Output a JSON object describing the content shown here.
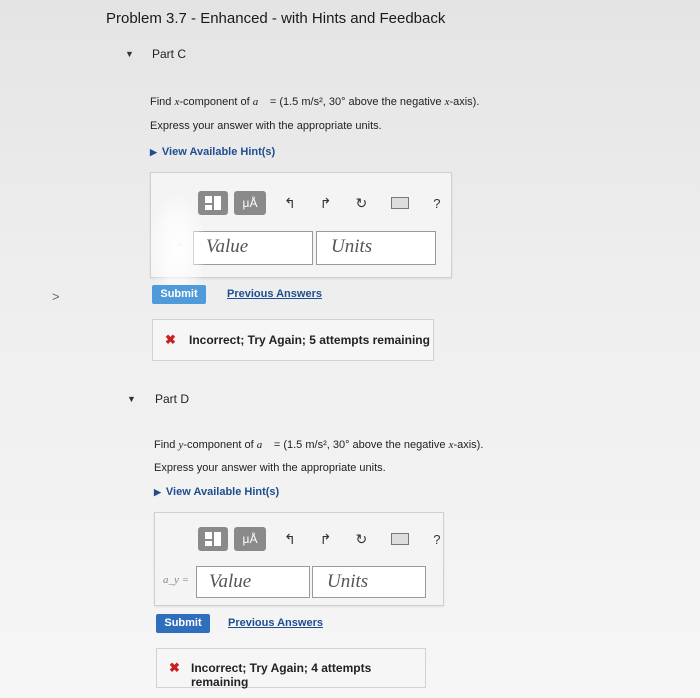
{
  "title": "Problem 3.7 - Enhanced - with Hints and Feedback",
  "nav": {
    "chevron": ">"
  },
  "parts": [
    {
      "id": "C",
      "label": "Part C",
      "question_prefix": "Find ",
      "question_var": "x",
      "question_mid": "-component of ",
      "vector": "a⃗",
      "question_value": " = (1.5 m/s², 30° above the negative ",
      "question_axis": "x",
      "question_suffix": "-axis).",
      "instruction": "Express your answer with the appropriate units.",
      "hint_link": "View Available Hint(s)",
      "units_btn": "μÅ",
      "help": "?",
      "input_label": "=",
      "value_placeholder": "Value",
      "units_placeholder": "Units",
      "submit": "Submit",
      "previous_answers": "Previous Answers",
      "feedback": "Incorrect; Try Again; 5 attempts remaining"
    },
    {
      "id": "D",
      "label": "Part D",
      "question_prefix": "Find ",
      "question_var": "y",
      "question_mid": "-component of ",
      "vector": "a⃗",
      "question_value": " = (1.5 m/s², 30° above the negative ",
      "question_axis": "x",
      "question_suffix": "-axis).",
      "instruction": "Express your answer with the appropriate units.",
      "hint_link": "View Available Hint(s)",
      "units_btn": "μÅ",
      "help": "?",
      "input_label": "a_y =",
      "value_placeholder": "Value",
      "units_placeholder": "Units",
      "submit": "Submit",
      "previous_answers": "Previous Answers",
      "feedback": "Incorrect; Try Again; 4 attempts remaining"
    }
  ],
  "icons": {
    "undo": "↰",
    "redo": "↱",
    "reset": "↻",
    "keyboard": "keyboard-icon",
    "expand_triangle": "▼",
    "hint_triangle": "▶",
    "incorrect_x": "✖"
  },
  "colors": {
    "submit": "#2f6ebc",
    "link": "#1f4d8f",
    "incorrect": "#cc1f1f"
  }
}
